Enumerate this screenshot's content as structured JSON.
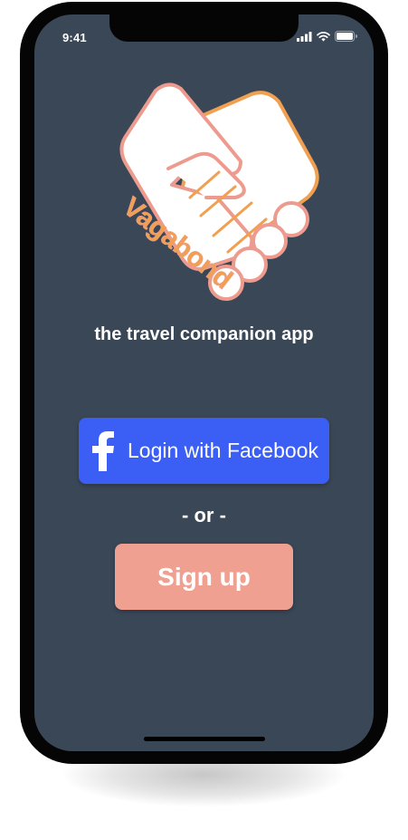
{
  "status_bar": {
    "time": "9:41",
    "icons": [
      "signal-icon",
      "wifi-icon",
      "battery-icon"
    ]
  },
  "logo": {
    "brand_text": "Vagabond",
    "icon": "handshake-icon",
    "colors": {
      "outline_left": "#ee9b8f",
      "outline_right": "#f0a050",
      "fill": "#ffffff",
      "text": "#f0a050"
    }
  },
  "tagline": "the travel companion app",
  "facebook_button": {
    "label": "Login with Facebook",
    "icon": "facebook-icon",
    "color": "#3b5ef4"
  },
  "separator": "- or -",
  "signup_button": {
    "label": "Sign up",
    "color": "#f0a090"
  },
  "colors": {
    "screen_background": "#3a4757",
    "phone_frame": "#050505"
  }
}
